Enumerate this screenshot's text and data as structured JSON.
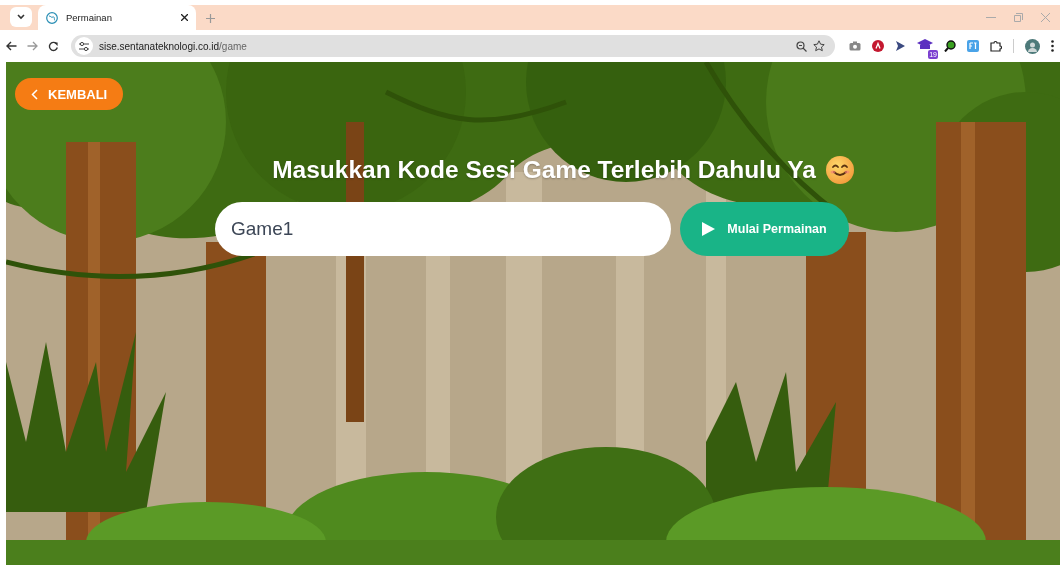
{
  "browser": {
    "tabs": [
      {
        "title": "Permainan",
        "selected": true
      }
    ],
    "address": {
      "host": "sise.sentanateknologi.co.id",
      "path": "/game"
    },
    "extension_badge": "19"
  },
  "page": {
    "back_button": {
      "label": "KEMBALI"
    },
    "heading": "Masukkan Kode Sesi Game Terlebih Dahulu Ya",
    "session_code": {
      "value": "Game1"
    },
    "start_button": {
      "label": "Mulai Permainan"
    }
  }
}
